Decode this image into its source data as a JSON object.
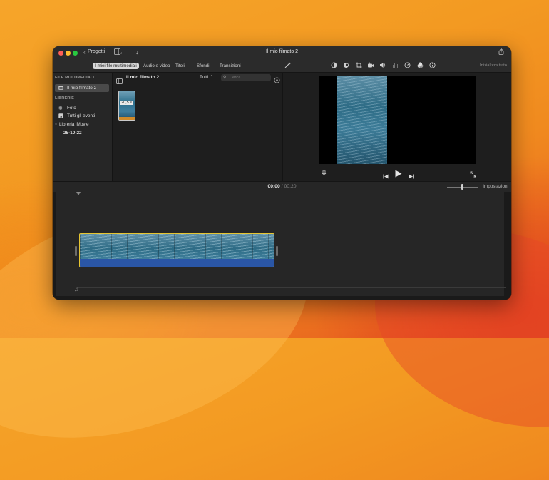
{
  "window": {
    "title": "Il mio filmato 2",
    "back_label": "Progetti"
  },
  "tabs": [
    "I miei file multimediali",
    "Audio e video",
    "Titoli",
    "Sfondi",
    "Transizioni"
  ],
  "viewer_toolbar": {
    "reset_label": "Inizializza tutto"
  },
  "sidebar": {
    "section_media": "FILE MULTIMEDIALI",
    "project_item": "Il mio filmato 2",
    "section_libraries": "LIBRERIE",
    "photos": "Foto",
    "all_events": "Tutti gli eventi",
    "library": "Libreria iMovie",
    "event": "25-10-22"
  },
  "browser": {
    "title": "Il mio filmato 2",
    "filter": "Tutti",
    "search_placeholder": "Cerca",
    "clip_duration": "20,5 s"
  },
  "timeline": {
    "current_time": "00:00",
    "separator": "/",
    "total_time": "00:20",
    "settings_label": "Impostazioni"
  },
  "icons": {
    "back": "chevron-left-icon",
    "media_view": "film-music-icon",
    "import": "down-arrow-icon",
    "share": "share-icon",
    "enhance": "magic-wand-icon"
  }
}
